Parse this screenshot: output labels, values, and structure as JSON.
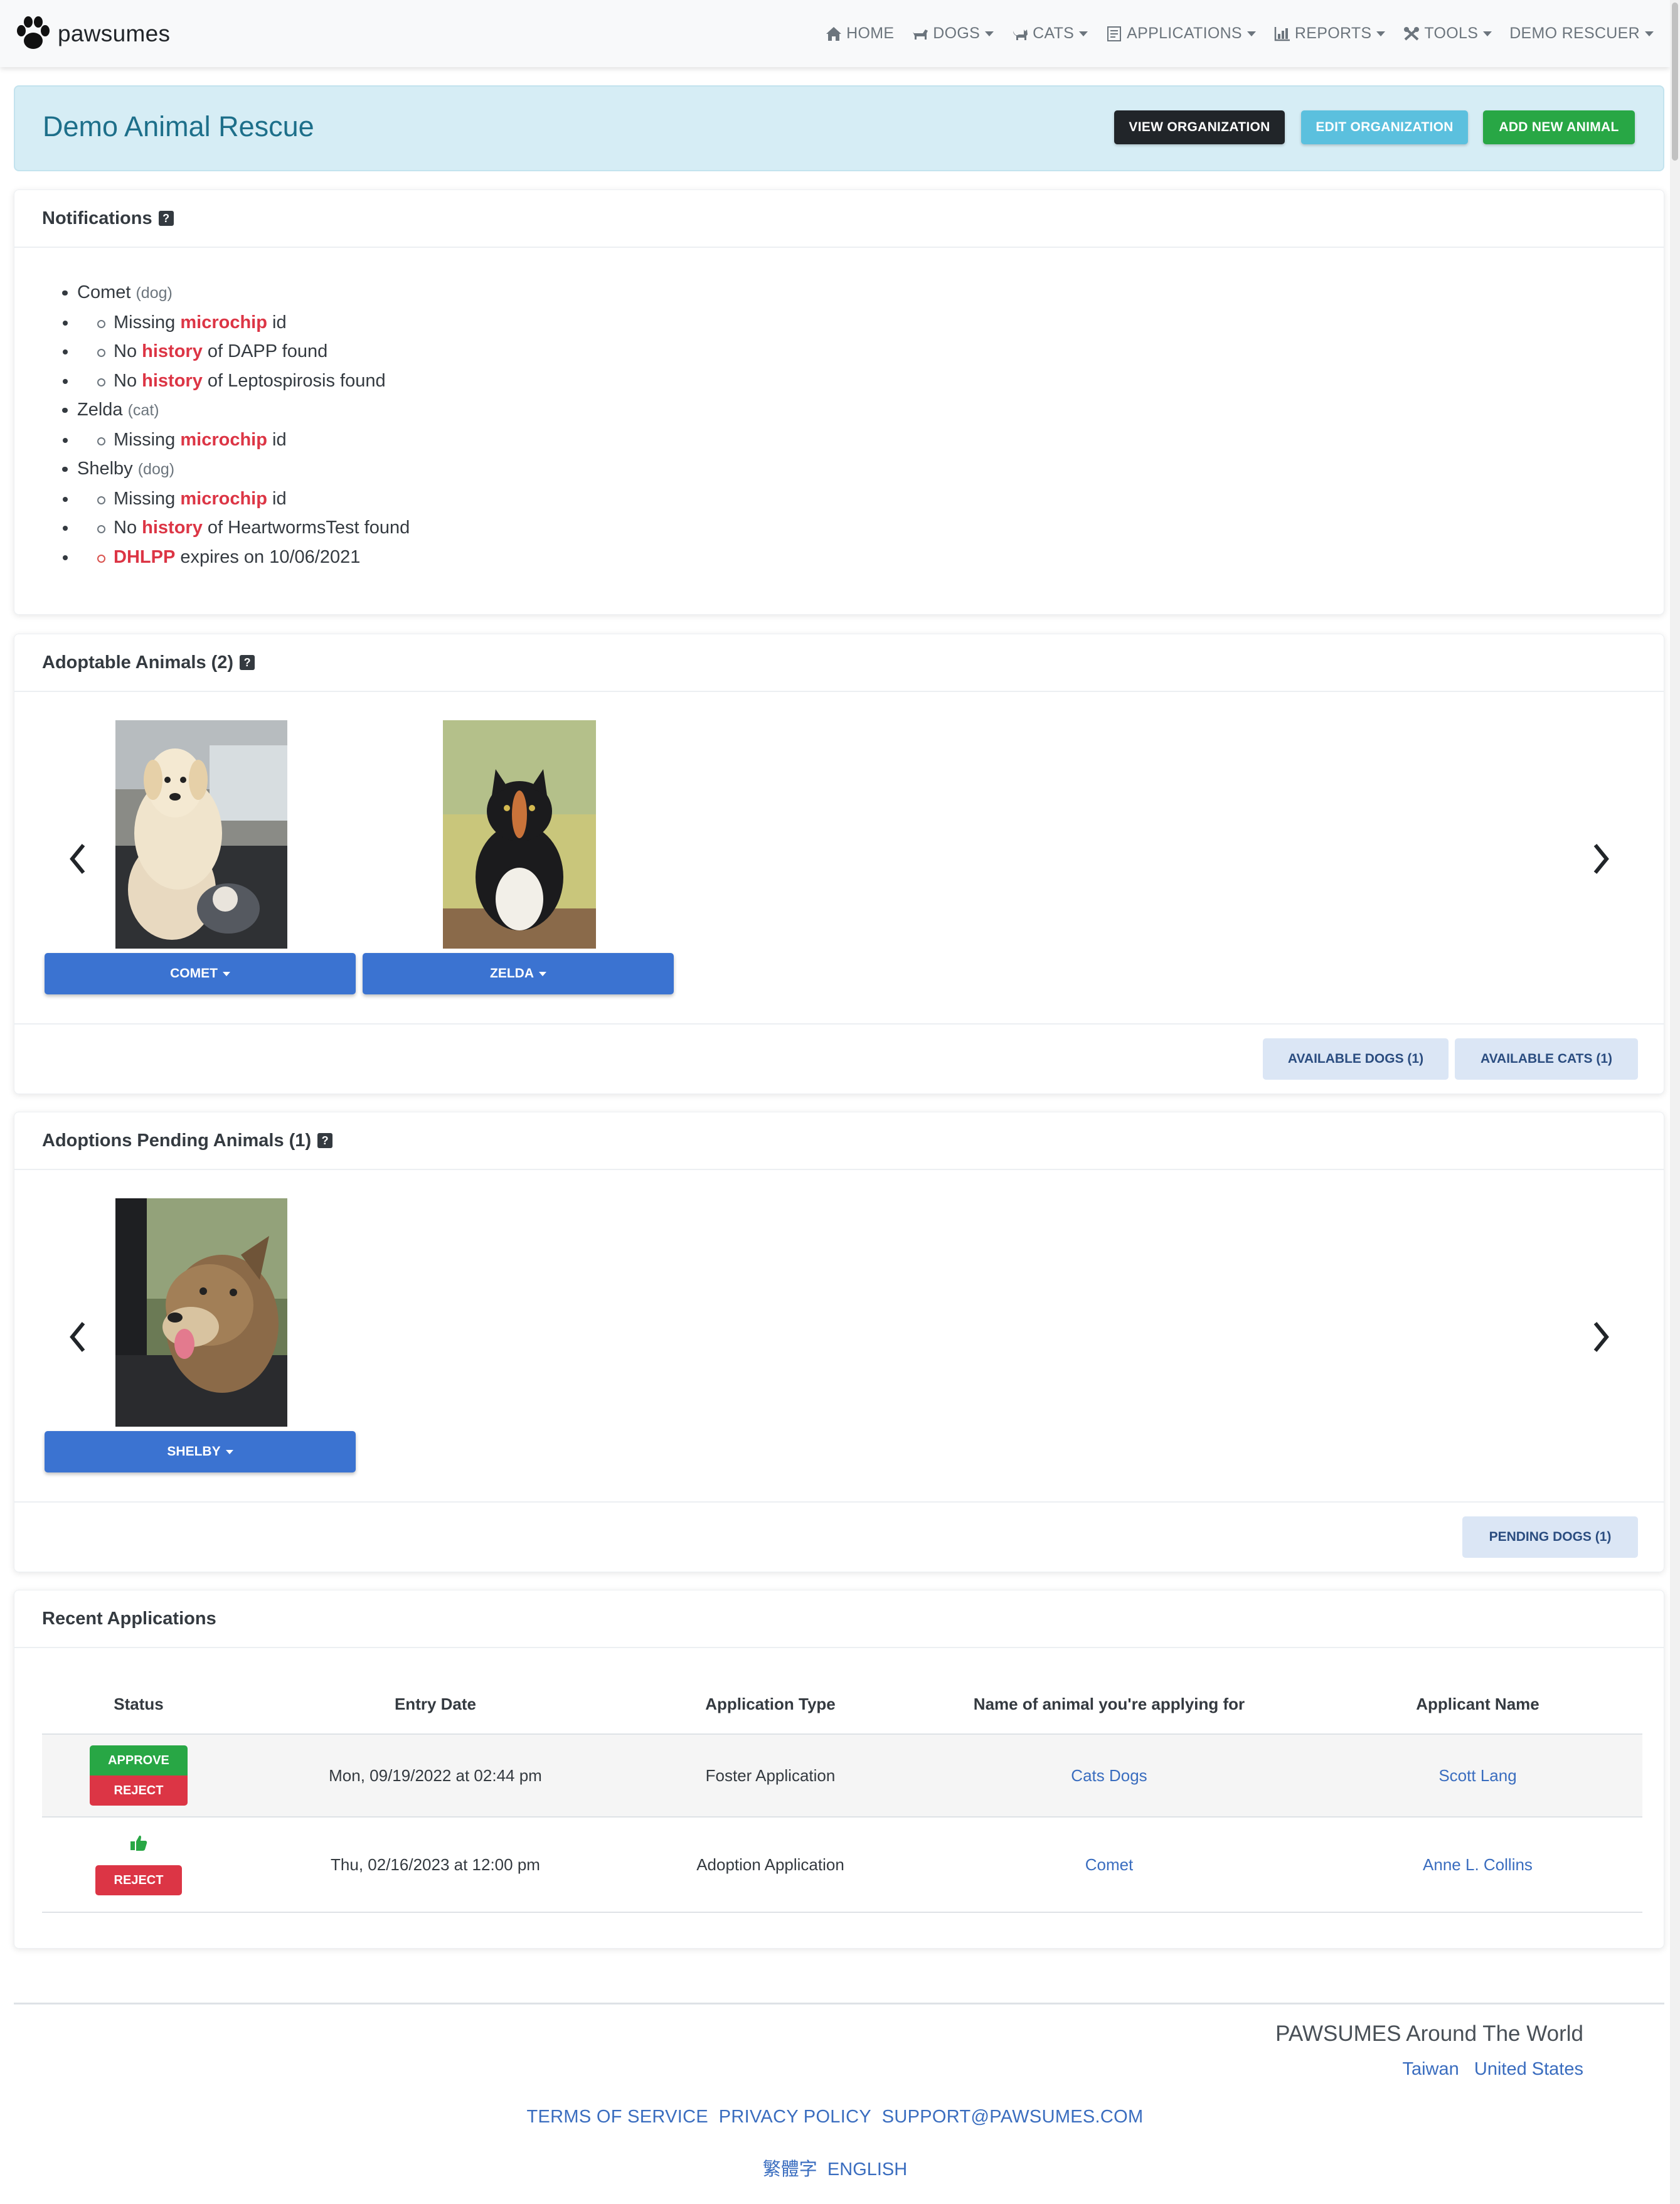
{
  "brand": {
    "name": "pawsumes"
  },
  "nav": [
    {
      "label": "HOME",
      "icon": "home-icon",
      "dropdown": false
    },
    {
      "label": "DOGS",
      "icon": "dog-icon",
      "dropdown": true
    },
    {
      "label": "CATS",
      "icon": "cat-icon",
      "dropdown": true
    },
    {
      "label": "APPLICATIONS",
      "icon": "applications-icon",
      "dropdown": true
    },
    {
      "label": "REPORTS",
      "icon": "reports-icon",
      "dropdown": true
    },
    {
      "label": "TOOLS",
      "icon": "tools-icon",
      "dropdown": true
    },
    {
      "label": "DEMO RESCUER",
      "icon": "",
      "dropdown": true
    }
  ],
  "header": {
    "title": "Demo Animal Rescue",
    "view_org": "VIEW ORGANIZATION",
    "edit_org": "EDIT ORGANIZATION",
    "add_animal": "ADD NEW ANIMAL"
  },
  "notifications": {
    "title": "Notifications",
    "items": [
      {
        "name": "Comet",
        "kind": "(dog)",
        "issues": [
          {
            "pre": "Missing ",
            "hl": "microchip",
            "post": " id"
          },
          {
            "pre": "No ",
            "hl": "history",
            "post": " of DAPP found"
          },
          {
            "pre": "No ",
            "hl": "history",
            "post": " of Leptospirosis found"
          }
        ]
      },
      {
        "name": "Zelda",
        "kind": "(cat)",
        "issues": [
          {
            "pre": "Missing ",
            "hl": "microchip",
            "post": " id"
          }
        ]
      },
      {
        "name": "Shelby",
        "kind": "(dog)",
        "issues": [
          {
            "pre": "Missing ",
            "hl": "microchip",
            "post": " id"
          },
          {
            "pre": "No ",
            "hl": "history",
            "post": " of HeartwormsTest found"
          },
          {
            "pre": "",
            "hl": "DHLPP",
            "post": " expires on 10/06/2021"
          }
        ]
      }
    ]
  },
  "adoptable": {
    "title": "Adoptable Animals (2)",
    "animals": [
      {
        "name": "COMET"
      },
      {
        "name": "ZELDA"
      }
    ],
    "available_dogs": "AVAILABLE DOGS (1)",
    "available_cats": "AVAILABLE CATS (1)"
  },
  "pending": {
    "title": "Adoptions Pending Animals (1)",
    "animals": [
      {
        "name": "SHELBY"
      }
    ],
    "pending_dogs": "PENDING DOGS (1)"
  },
  "applications": {
    "title": "Recent Applications",
    "columns": [
      "Status",
      "Entry Date",
      "Application Type",
      "Name of animal you're applying for",
      "Applicant Name"
    ],
    "rows": [
      {
        "approve": "APPROVE",
        "reject": "REJECT",
        "date": "Mon, 09/19/2022 at 02:44 pm",
        "type": "Foster Application",
        "animal": "Cats Dogs",
        "applicant": "Scott Lang"
      },
      {
        "approved_icon": "thumbs-up-icon",
        "reject": "REJECT",
        "date": "Thu, 02/16/2023 at 12:00 pm",
        "type": "Adoption Application",
        "animal": "Comet",
        "applicant": "Anne L. Collins"
      }
    ]
  },
  "footer": {
    "title": "PAWSUMES Around The World",
    "countries": [
      "Taiwan",
      "United States"
    ],
    "legal": [
      "TERMS OF SERVICE",
      "PRIVACY POLICY",
      "SUPPORT@PAWSUMES.COM"
    ],
    "languages": [
      "繁體字",
      "ENGLISH"
    ]
  },
  "colors": {
    "accent_blue": "#3b73d1",
    "banner_bg": "#d6edf5",
    "title_teal": "#1d6f8a",
    "danger": "#dc3545",
    "success": "#28a745"
  }
}
